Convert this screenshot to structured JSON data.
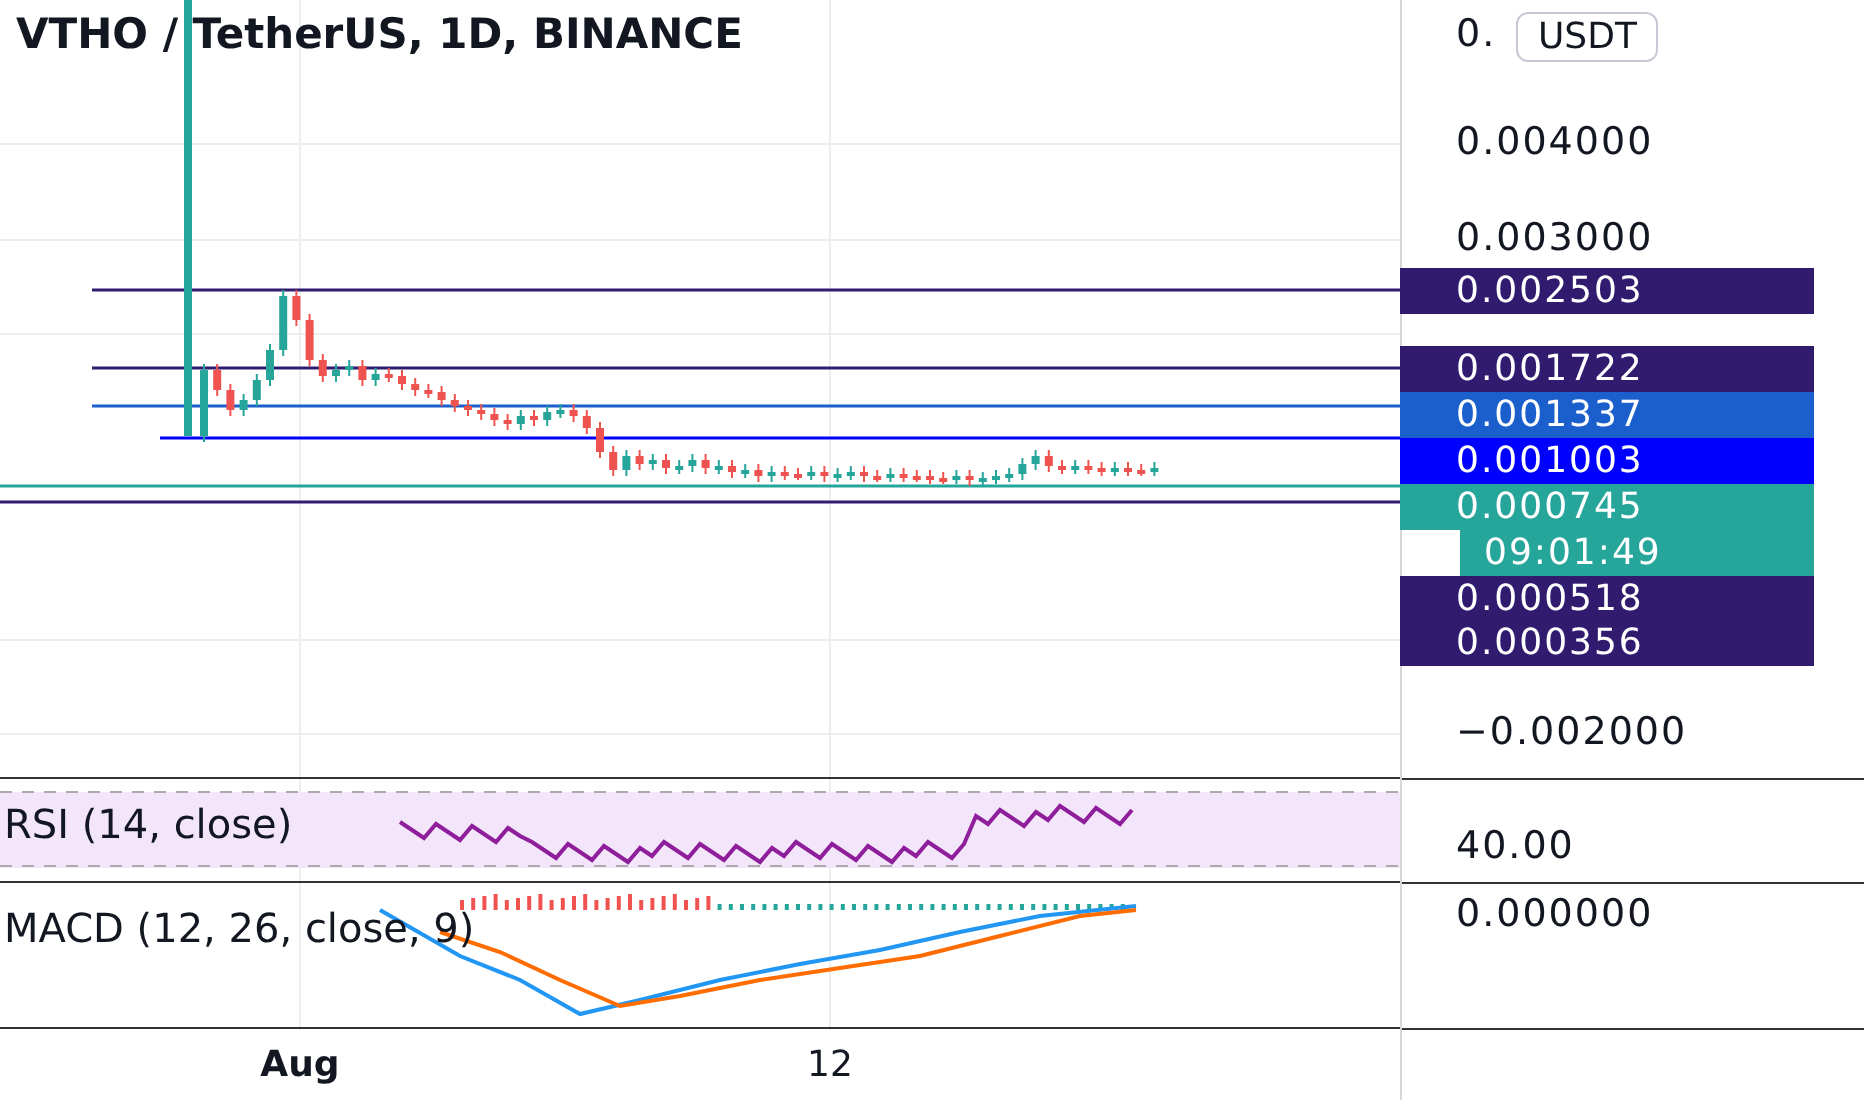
{
  "header": {
    "title": "VTHO / TetherUS, 1D, BINANCE"
  },
  "currency_button": {
    "label": "USDT"
  },
  "price_axis": {
    "ticks": [
      "0.",
      "0.004000",
      "0.003000",
      "−0.002000"
    ]
  },
  "price_labels": [
    {
      "kind": "price",
      "text": "0.002503",
      "color": "#311b6e"
    },
    {
      "kind": "price",
      "text": "0.001722",
      "color": "#311b6e"
    },
    {
      "kind": "price",
      "text": "0.001337",
      "color": "#1a5fcc"
    },
    {
      "kind": "price",
      "text": "0.001003",
      "color": "#0000ff"
    },
    {
      "kind": "price",
      "text": "0.000745",
      "color": "#26a69a"
    },
    {
      "kind": "countdown",
      "text": "09:01:49",
      "color": "#26a69a"
    },
    {
      "kind": "price",
      "text": "0.000518",
      "color": "#311b6e"
    },
    {
      "kind": "price",
      "text": "0.000356",
      "color": "#311b6e"
    }
  ],
  "rsi": {
    "title": "RSI (14, close)",
    "axis_label": "40.00"
  },
  "macd": {
    "title": "MACD (12, 26, close, 9)",
    "axis_label": "0.000000"
  },
  "time_axis": {
    "labels": [
      {
        "text": "Aug",
        "bold": true
      },
      {
        "text": "12",
        "bold": false
      }
    ]
  }
}
